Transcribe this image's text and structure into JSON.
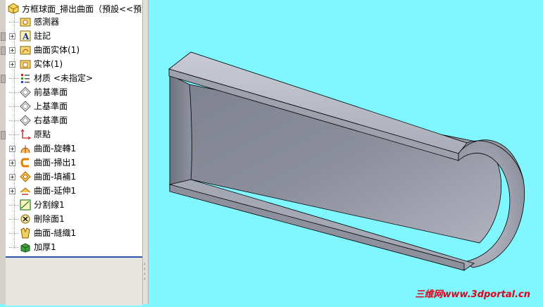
{
  "feature_tree": {
    "root": {
      "label": "方框球面_掃出曲面（預設<<預設",
      "icon": "part-icon"
    },
    "items": [
      {
        "label": "感測器",
        "icon": "sensor-folder-icon",
        "expandable": false
      },
      {
        "label": "註記",
        "icon": "annotations-icon",
        "expandable": true
      },
      {
        "label": "曲面实体(1)",
        "icon": "surface-bodies-folder-icon",
        "expandable": true
      },
      {
        "label": "实体(1)",
        "icon": "solid-bodies-folder-icon",
        "expandable": true
      },
      {
        "label": "材质 <未指定>",
        "icon": "material-icon",
        "expandable": false
      },
      {
        "label": "前基準面",
        "icon": "plane-icon",
        "expandable": false
      },
      {
        "label": "上基準面",
        "icon": "plane-icon",
        "expandable": false
      },
      {
        "label": "右基準面",
        "icon": "plane-icon",
        "expandable": false
      },
      {
        "label": "原點",
        "icon": "origin-icon",
        "expandable": false
      },
      {
        "label": "曲面-旋轉1",
        "icon": "surface-revolve-icon",
        "expandable": true
      },
      {
        "label": "曲面-掃出1",
        "icon": "surface-sweep-icon",
        "expandable": true
      },
      {
        "label": "曲面-填補1",
        "icon": "surface-fill-icon",
        "expandable": true
      },
      {
        "label": "曲面-延伸1",
        "icon": "surface-extend-icon",
        "expandable": true
      },
      {
        "label": "分割線1",
        "icon": "split-line-icon",
        "expandable": false
      },
      {
        "label": "刪除面1",
        "icon": "delete-face-icon",
        "expandable": false
      },
      {
        "label": "曲面-縫織1",
        "icon": "surface-knit-icon",
        "expandable": false
      },
      {
        "label": "加厚1",
        "icon": "thicken-icon",
        "expandable": false
      }
    ]
  },
  "watermark": "三维网www.3dportal.cn",
  "colors": {
    "viewport_background": "#80f6ff",
    "model_face": "#8a8d99",
    "model_edge": "#000000",
    "watermark": "#e2001a"
  }
}
